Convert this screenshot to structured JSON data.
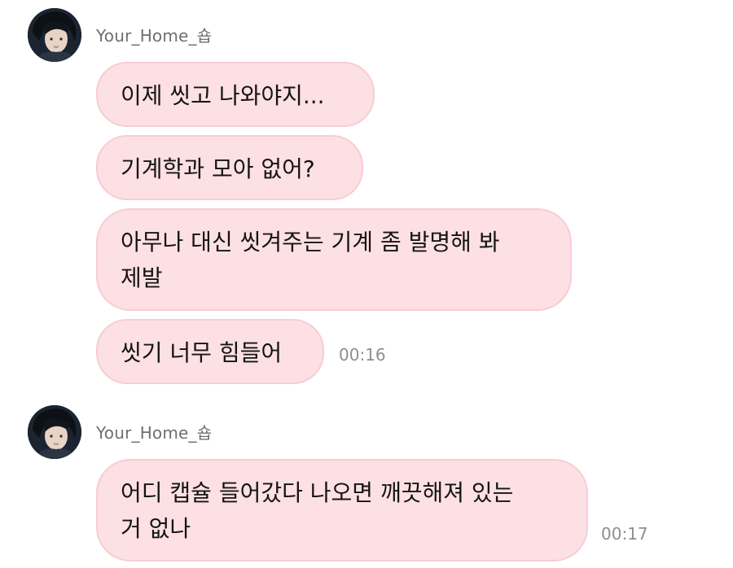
{
  "colors": {
    "bubble_bg": "#fde0e4",
    "bubble_border": "#f6cdd3",
    "sender_text": "#6f6f6f",
    "time_text": "#8e8e8e",
    "background": "#ffffff"
  },
  "groups": [
    {
      "sender": "Your_Home_숍",
      "avatar_icon": "profile-photo",
      "messages": [
        {
          "text": "이제 씻고 나와야지..."
        },
        {
          "text": "기계학과 모아 없어?"
        },
        {
          "text": "아무나 대신 씻겨주는 기계 좀 발명해 봐\n제발"
        },
        {
          "text": "씻기 너무 힘들어",
          "time": "00:16"
        }
      ]
    },
    {
      "sender": "Your_Home_숍",
      "avatar_icon": "profile-photo",
      "messages": [
        {
          "text": "어디 캡슐 들어갔다 나오면 깨끗해져 있는\n거 없나",
          "time": "00:17"
        }
      ]
    }
  ]
}
